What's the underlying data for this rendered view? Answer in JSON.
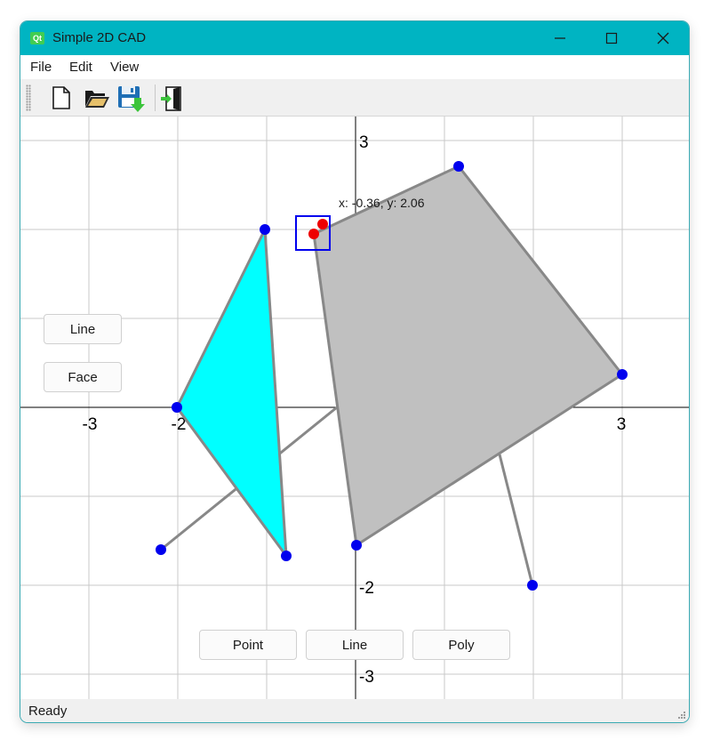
{
  "window": {
    "title": "Simple 2D CAD",
    "app_icon_text": "Qt"
  },
  "menu": {
    "items": [
      {
        "label": "File"
      },
      {
        "label": "Edit"
      },
      {
        "label": "View"
      }
    ]
  },
  "toolbar": {
    "tools": [
      {
        "icon": "new-file-icon"
      },
      {
        "icon": "open-folder-icon"
      },
      {
        "icon": "save-icon"
      },
      {
        "icon": "exit-icon"
      }
    ]
  },
  "canvas": {
    "axis_labels": {
      "x_neg3": "-3",
      "x_neg2": "-2",
      "x_pos3": "3",
      "y_pos3": "3",
      "y_neg2": "-2",
      "y_neg3": "-3"
    },
    "cursor_readout": "x: -0.36, y: 2.06",
    "colors": {
      "grid": "#c8c8c8",
      "axis": "#000000",
      "edge": "#888888",
      "triangle_fill": "#00ffff",
      "quad_fill": "#c0c0c0",
      "vertex": "#0000ee",
      "selected_vertex": "#ee0000",
      "selection_box": "#0000ee"
    }
  },
  "side_buttons": {
    "line": "Line",
    "face": "Face"
  },
  "bottom_buttons": {
    "point": "Point",
    "line": "Line",
    "poly": "Poly"
  },
  "status": {
    "text": "Ready"
  }
}
